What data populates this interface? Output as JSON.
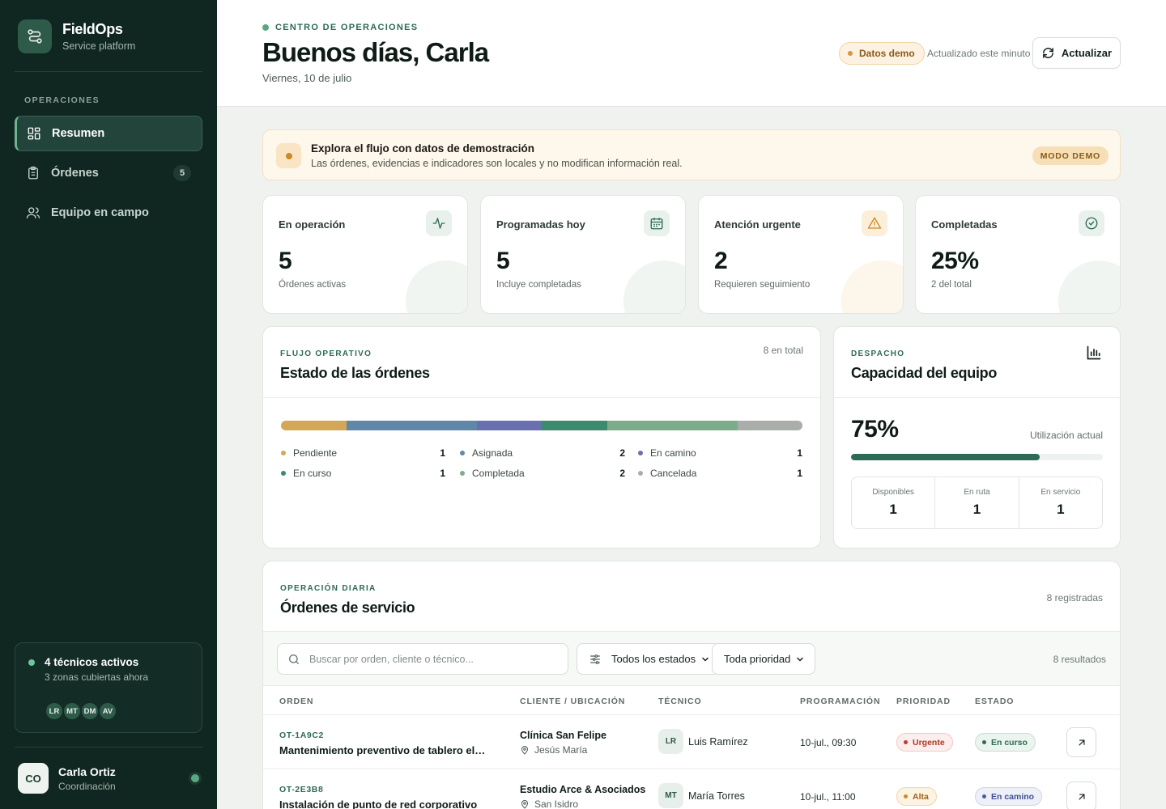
{
  "brand": {
    "name": "FieldOps",
    "subtitle": "Service platform"
  },
  "sidebar": {
    "section_label": "OPERACIONES",
    "items": [
      {
        "label": "Resumen",
        "icon": "dashboard-icon",
        "active": true
      },
      {
        "label": "Órdenes",
        "icon": "clipboard-icon",
        "count": "5"
      },
      {
        "label": "Equipo en campo",
        "icon": "users-icon"
      }
    ],
    "active_card": {
      "title": "4 técnicos activos",
      "subtitle": "3 zonas cubiertas ahora",
      "avatars": [
        "LR",
        "MT",
        "DM",
        "AV"
      ]
    },
    "user": {
      "initials": "CO",
      "name": "Carla Ortiz",
      "role": "Coordinación"
    }
  },
  "header": {
    "eyebrow": "CENTRO DE OPERACIONES",
    "greeting": "Buenos días, Carla",
    "date": "Viernes, 10 de julio",
    "demo_pill": "Datos demo",
    "updated": "Actualizado este minuto",
    "refresh_label": "Actualizar"
  },
  "banner": {
    "title": "Explora el flujo con datos de demostración",
    "subtitle": "Las órdenes, evidencias e indicadores son locales y no modifican información real.",
    "tag": "MODO DEMO"
  },
  "kpis": [
    {
      "label": "En operación",
      "value": "5",
      "sub": "Órdenes activas",
      "icon": "activity-icon",
      "accent": "#2d6b55"
    },
    {
      "label": "Programadas hoy",
      "value": "5",
      "sub": "Incluye completadas",
      "icon": "calendar-icon",
      "accent": "#2d6b55"
    },
    {
      "label": "Atención urgente",
      "value": "2",
      "sub": "Requieren seguimiento",
      "icon": "alert-icon",
      "accent": "#c98a2a"
    },
    {
      "label": "Completadas",
      "value": "25%",
      "sub": "2 del total",
      "icon": "check-circle-icon",
      "accent": "#2d6b55"
    }
  ],
  "status_card": {
    "eyebrow": "FLUJO OPERATIVO",
    "title": "Estado de las órdenes",
    "total": "8 en total",
    "statuses": [
      {
        "label": "Pendiente",
        "value": 1,
        "color": "#d4a657"
      },
      {
        "label": "Asignada",
        "value": 2,
        "color": "#5f87a8"
      },
      {
        "label": "En camino",
        "value": 1,
        "color": "#6a6fb0"
      },
      {
        "label": "En curso",
        "value": 1,
        "color": "#3d8a6e"
      },
      {
        "label": "Completada",
        "value": 2,
        "color": "#7dac8a"
      },
      {
        "label": "Cancelada",
        "value": 1,
        "color": "#a9aeab"
      }
    ]
  },
  "capacity_card": {
    "eyebrow": "DESPACHO",
    "title": "Capacidad del equipo",
    "value": "75%",
    "utilization": 0.75,
    "note": "Utilización actual",
    "stats": [
      {
        "label": "Disponibles",
        "value": "1"
      },
      {
        "label": "En ruta",
        "value": "1"
      },
      {
        "label": "En servicio",
        "value": "1"
      }
    ]
  },
  "orders": {
    "eyebrow": "OPERACIÓN DIARIA",
    "title": "Órdenes de servicio",
    "registered": "8 registradas",
    "search_placeholder": "Buscar por orden, cliente o técnico...",
    "status_filter": "Todos los estados",
    "priority_filter": "Toda prioridad",
    "results": "8 resultados",
    "columns": [
      "ORDEN",
      "CLIENTE / UBICACIÓN",
      "TÉCNICO",
      "PROGRAMACIÓN",
      "PRIORIDAD",
      "ESTADO"
    ],
    "rows": [
      {
        "id": "OT-1A9C2",
        "title": "Mantenimiento preventivo de tablero eléctrico",
        "client": "Clínica San Felipe",
        "location": "Jesús María",
        "tech_initials": "LR",
        "tech": "Luis Ramírez",
        "schedule": "10-jul., 09:30",
        "priority": "Urgente",
        "priority_color": "#c0392b",
        "status": "En curso",
        "status_color": "#2d6b55"
      },
      {
        "id": "OT-2E3B8",
        "title": "Instalación de punto de red corporativo",
        "client": "Estudio Arce & Asociados",
        "location": "San Isidro",
        "tech_initials": "MT",
        "tech": "María Torres",
        "schedule": "10-jul., 11:00",
        "priority": "Alta",
        "priority_color": "#b87a1f",
        "status": "En camino",
        "status_color": "#4a5ca0"
      }
    ]
  }
}
